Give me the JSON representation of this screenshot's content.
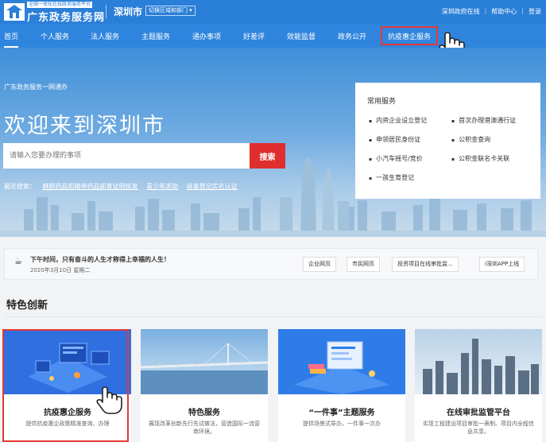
{
  "header": {
    "platform_tag": "全国一体化在线政务服务平台",
    "site_title": "广东政务服务网",
    "city": "深圳市",
    "switch_region": "切换区域和部门",
    "links": [
      "深圳政府在线",
      "帮助中心",
      "登录"
    ]
  },
  "nav": {
    "items": [
      "首页",
      "个人服务",
      "法人服务",
      "主题服务",
      "通办事项",
      "好差评",
      "效能监督",
      "政务公开",
      "抗疫惠企服务"
    ]
  },
  "hero": {
    "subtitle": "广东政务服务一网通办",
    "title": "欢迎来到深圳市",
    "search_placeholder": "请输入您要办理的事项",
    "search_button": "搜索",
    "recent_label": "最近搜索：",
    "recent_keywords": [
      "麻醉药品和精神药品邮寄证明核发",
      "青少年求助",
      "商事登记实名认证"
    ]
  },
  "common_services": {
    "title": "常用服务",
    "items": [
      "内资企业设立登记",
      "首次办理港澳通行证",
      "申领居民身份证",
      "公积金查询",
      "小汽车摇号/竞价",
      "公积金联名卡关联",
      "一孩生育登记"
    ]
  },
  "notice": {
    "text": "下午时间，只有奋斗的人生才称得上幸福的人生！",
    "date": "2020年3月10日 星期二",
    "buttons": [
      "企业网页",
      "市民网页",
      "投资项目在线审批监...",
      "i深圳APP上线"
    ]
  },
  "features": {
    "title": "特色创新",
    "cards": [
      {
        "title": "抗疫惠企服务",
        "desc": "提供抗疫惠企政策精准查询、办理"
      },
      {
        "title": "特色服务",
        "desc": "展现改革创新先行先试做法，营造国际一流营商环境。"
      },
      {
        "title": "“一件事”主题服务",
        "desc": "提供场景式导办，一件事一次办"
      },
      {
        "title": "在线审批监管平台",
        "desc": "实现工程建设项目审批一表制、项目内全程信息共享。"
      }
    ]
  },
  "colors": {
    "brand_blue": "#2a7fd8",
    "search_red": "#e02e2e",
    "highlight_red": "#e53935"
  }
}
